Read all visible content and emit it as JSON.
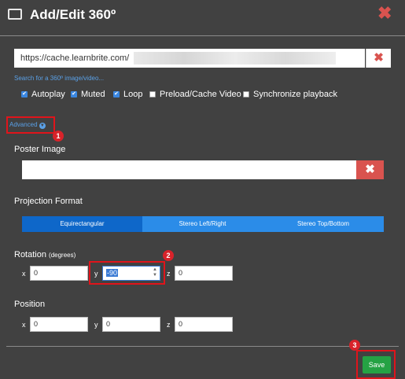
{
  "header": {
    "title": "Add/Edit 360º",
    "close_icon": "x-icon"
  },
  "url": {
    "value": "https://cache.learnbrite.com/"
  },
  "search_link": "Search for a 360º image/video...",
  "checkboxes": [
    {
      "label": "Autoplay",
      "checked": true
    },
    {
      "label": "Muted",
      "checked": true
    },
    {
      "label": "Loop",
      "checked": true
    },
    {
      "label": "Preload/Cache Video",
      "checked": false
    },
    {
      "label": "Synchronize playback",
      "checked": false
    }
  ],
  "advanced": {
    "label": "Advanced",
    "badge": "1"
  },
  "poster": {
    "label": "Poster Image",
    "value": ""
  },
  "projection": {
    "label": "Projection Format",
    "options": [
      "Equirectangular",
      "Stereo Left/Right",
      "Stereo Top/Bottom"
    ],
    "selected": "Equirectangular"
  },
  "rotation": {
    "label": "Rotation",
    "unit": "(degrees)",
    "x_label": "x",
    "x": "0",
    "y_label": "y",
    "y": "-90",
    "z_label": "z",
    "z": "0",
    "badge": "2"
  },
  "position": {
    "label": "Position",
    "x_label": "x",
    "x": "0",
    "y_label": "y",
    "y": "0",
    "z_label": "z",
    "z": "0"
  },
  "footer": {
    "save_label": "Save",
    "badge": "3"
  },
  "colors": {
    "accent": "#0e67c9",
    "danger": "#d9534f",
    "save": "#25a244",
    "highlight": "#e0141b"
  }
}
